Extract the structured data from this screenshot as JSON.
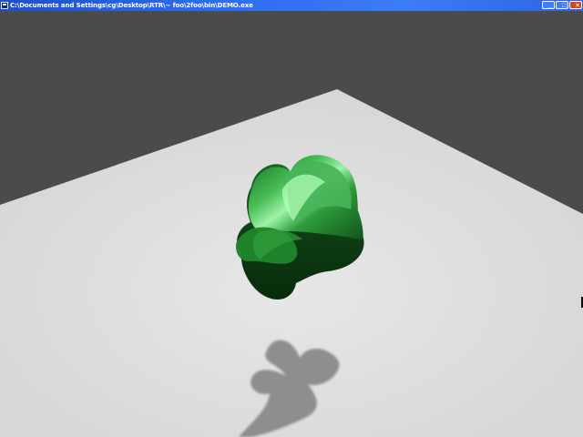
{
  "window": {
    "title": "C:\\Documents and Settings\\cg\\Desktop\\RTR\\~ foo\\2foo\\bin\\DEMO.exe",
    "controls": {
      "minimize": "_",
      "maximize": "□",
      "close": "×"
    }
  },
  "icons": {
    "app": "app-icon",
    "minimize": "minimize-icon",
    "maximize": "maximize-icon",
    "close": "close-icon"
  },
  "colors": {
    "titlebar": "#2c6bf0",
    "background": "#4b4b4b",
    "floor": "#dedede",
    "shadow": "#8a8a8a",
    "object_light": "#7ef08a",
    "object_mid": "#1f9f35",
    "object_dark": "#0d3d13"
  }
}
